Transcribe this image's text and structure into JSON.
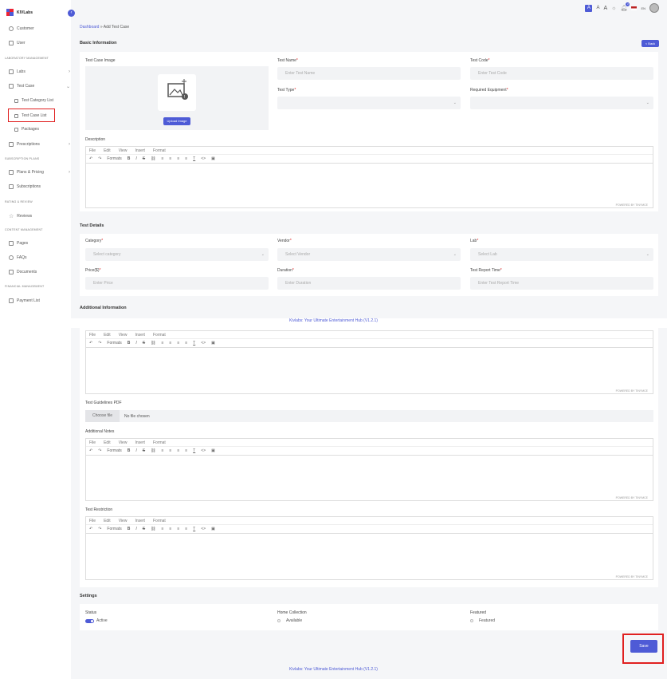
{
  "app": {
    "brand": "KIVLabs"
  },
  "topbar": {
    "font_sizes": [
      "A",
      "A",
      "A"
    ],
    "notif_count": "2",
    "lang": "EN"
  },
  "sidebar": {
    "items": [
      {
        "label": "Customer",
        "icon": "user-icon"
      },
      {
        "label": "User",
        "icon": "users-icon"
      }
    ],
    "section1": "LABORATORY MANAGEMENT",
    "labs": "Labs",
    "test_case": "Test Case",
    "test_category_list": "Test Category List",
    "test_case_list": "Test Case List",
    "packages": "Packages",
    "prescriptions": "Prescriptions",
    "section2": "SUBSCRIPTION PLANS",
    "plans_pricing": "Plans & Pricing",
    "subscriptions": "Subscriptions",
    "section3": "RATING & REVIEW",
    "reviews": "Reviews",
    "section4": "CONTENT MANAGEMENT",
    "pages": "Pages",
    "faqs": "FAQs",
    "documents": "Documents",
    "section5": "FINANCIAL MANAGEMENT",
    "payment_list": "Payment List"
  },
  "breadcrumb": {
    "home": "Dashboard",
    "sep": "»",
    "current": "Add Test Case"
  },
  "basic": {
    "heading": "Basic Information",
    "back_label": "< Back",
    "image_label": "Test Case Image",
    "upload_label": "Upload Image",
    "name_label": "Test Name",
    "name_placeholder": "Enter Test Name",
    "code_label": "Test Code",
    "code_placeholder": "Enter Test Code",
    "type_label": "Test Type",
    "equip_label": "Required Equipment",
    "desc_label": "Description"
  },
  "editor": {
    "menu": [
      "File",
      "Edit",
      "View",
      "Insert",
      "Format"
    ],
    "formats": "Formats",
    "tools": [
      "↶",
      "↷",
      "B",
      "I",
      "S",
      "🔗",
      "≡",
      "≡",
      "≡",
      "≡",
      "T",
      "<>",
      "▣"
    ],
    "powered": "POWERED BY TINYMCE"
  },
  "details": {
    "heading": "Test Details",
    "category_label": "Category",
    "category_ph": "Select category",
    "vendor_label": "Vendor",
    "vendor_ph": "Select Vendor",
    "lab_label": "Lab",
    "lab_ph": "Select Lab",
    "price_label": "Price($)",
    "price_ph": "Enter Price",
    "duration_label": "Duration",
    "duration_ph": "Enter Duration",
    "report_label": "Test Report Time",
    "report_ph": "Enter Test Report Time"
  },
  "additional": {
    "heading": "Additional Information",
    "guidelines_label": "Test Guidelines PDF",
    "choose_file": "Choose file",
    "no_file": "No file chosen",
    "notes_label": "Additional Notes",
    "restriction_label": "Test Restriction"
  },
  "settings": {
    "heading": "Settings",
    "status_label": "Status",
    "status_value": "Active",
    "home_label": "Home Collection",
    "home_value": "Available",
    "featured_label": "Featured",
    "featured_value": "Featured"
  },
  "save_label": "Save",
  "footer": "Kivlabs: Your Ultimate Entertainment Hub (V1.2.1)",
  "colors": {
    "accent": "#4e5bd6",
    "highlight": "#e02020"
  }
}
